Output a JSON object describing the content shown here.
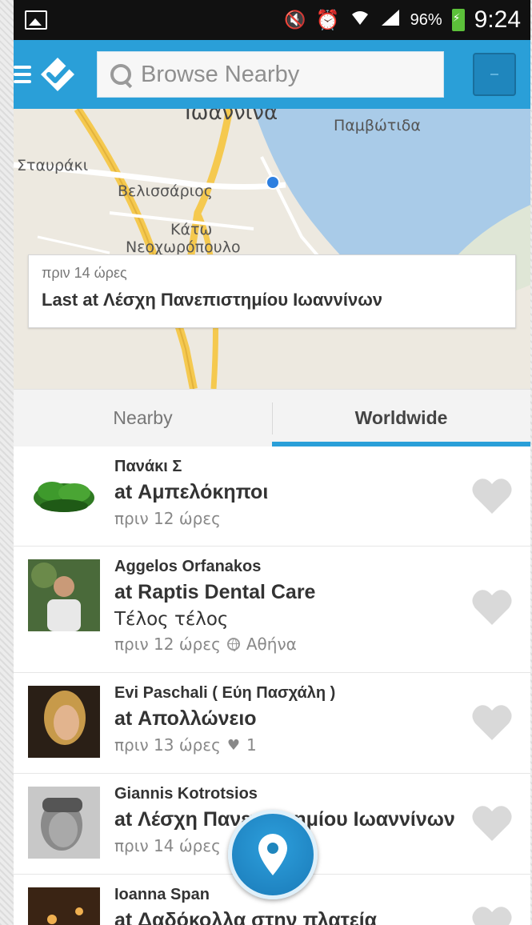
{
  "status_bar": {
    "battery_percent": "96%",
    "time": "9:24"
  },
  "search": {
    "placeholder": "Browse Nearby"
  },
  "map": {
    "labels": {
      "city_partial": "Ιωάννινα",
      "pamvotida": "Παμβώτιδα",
      "stavraki": "Σταυράκι",
      "velissarios": "Βελισσάριος",
      "kato": "Κάτω",
      "neochoropoulo": "Νεοχωρόπουλο"
    }
  },
  "last_checkin": {
    "time": "πριν 14 ώρες",
    "venue": "Last at Λέσχη Πανεπιστημίου Ιωαννίνων"
  },
  "tabs": [
    {
      "label": "Nearby",
      "active": false
    },
    {
      "label": "Worldwide",
      "active": true
    }
  ],
  "feed": [
    {
      "user": "Πανάκι Σ",
      "venue": "at Αμπελόκηποι",
      "time": "πριν 12 ώρες"
    },
    {
      "user": "Aggelos Orfanakos",
      "venue": "at Raptis Dental Care",
      "shout": "Τέλος τέλος",
      "time": "πριν 12 ώρες",
      "location": "Αθήνα"
    },
    {
      "user": "Evi Paschali ( Εύη Πασχάλη )",
      "venue": "at Απολλώνειο",
      "time": "πριν 13 ώρες",
      "likes": "1"
    },
    {
      "user": "Giannis Kotrotsios",
      "venue": "at Λέσχη Πανεπιστημίου Ιωαννίνων",
      "time": "πριν 14 ώρες"
    },
    {
      "user": "Ioanna Span",
      "venue": "at Δαδόκολλα στην πλατεία"
    }
  ],
  "colors": {
    "brand": "#2a9fd8",
    "heart": "#d9d9d9",
    "lake": "#a9cbe8"
  }
}
